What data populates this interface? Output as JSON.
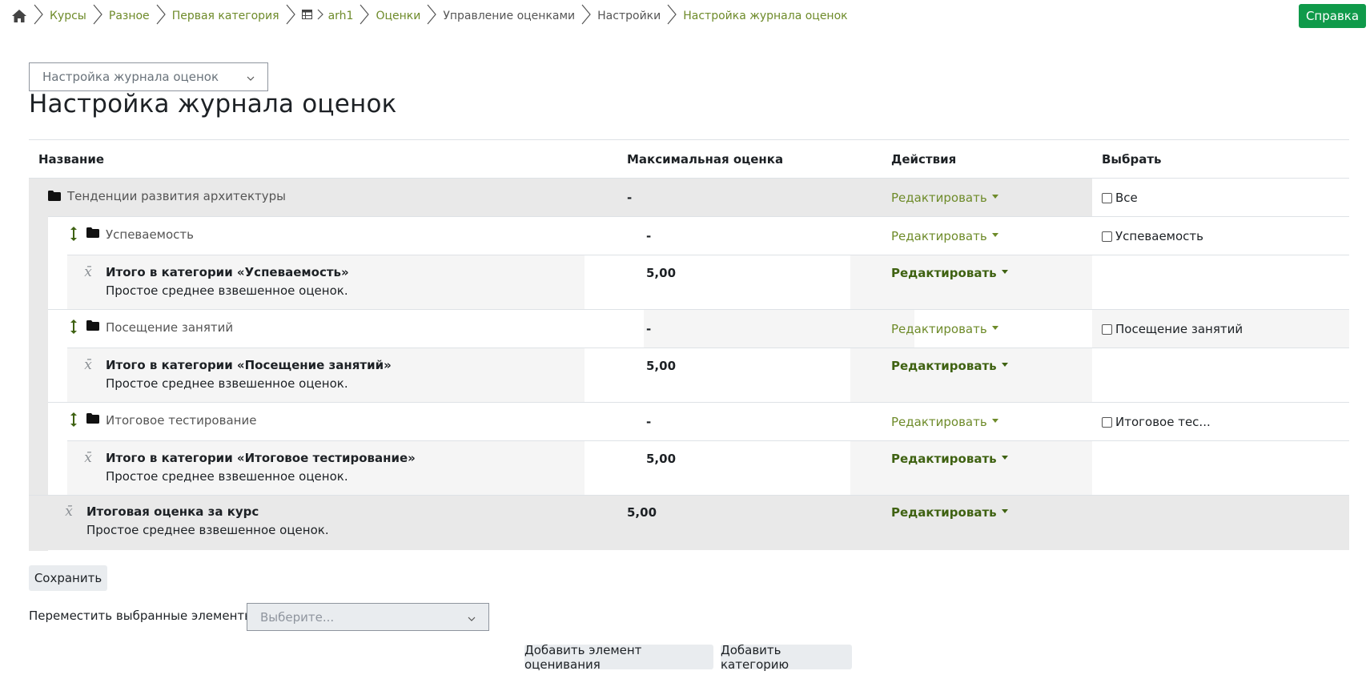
{
  "breadcrumb": {
    "items": [
      {
        "label": "Курсы",
        "link": true
      },
      {
        "label": "Разное",
        "link": true
      },
      {
        "label": "Первая категория",
        "link": true
      },
      {
        "label": "arh1",
        "link": true
      },
      {
        "label": "Оценки",
        "link": true
      },
      {
        "label": "Управление оценками",
        "link": false
      },
      {
        "label": "Настройки",
        "link": false
      },
      {
        "label": "Настройка журнала оценок",
        "link": true
      }
    ]
  },
  "help_button": "Справка",
  "nav_select": {
    "value": "Настройка журнала оценок"
  },
  "page_title": "Настройка журнала оценок",
  "table": {
    "headers": {
      "name": "Название",
      "max": "Максимальная оценка",
      "actions": "Действия",
      "select": "Выбрать"
    },
    "edit_label": "Редактировать",
    "rows": {
      "root": {
        "name": "Тенденции развития архитектуры",
        "max": "-",
        "select": "Все"
      },
      "cat1": {
        "name": "Успеваемость",
        "max": "-",
        "select": "Успеваемость"
      },
      "total1": {
        "name": "Итого в категории «Успеваемость»",
        "sub": "Простое среднее взвешенное оценок.",
        "max": "5,00"
      },
      "cat2": {
        "name": "Посещение занятий",
        "max": "-",
        "select": "Посещение занятий"
      },
      "total2": {
        "name": "Итого в категории «Посещение занятий»",
        "sub": "Простое среднее взвешенное оценок.",
        "max": "5,00"
      },
      "cat3": {
        "name": "Итоговое тестирование",
        "max": "-",
        "select": "Итоговое тес..."
      },
      "total3": {
        "name": "Итого в категории «Итоговое тестирование»",
        "sub": "Простое среднее взвешенное оценок.",
        "max": "5,00"
      },
      "course": {
        "name": "Итоговая оценка за курс",
        "sub": "Простое среднее взвешенное оценок.",
        "max": "5,00"
      }
    }
  },
  "save_button": "Сохранить",
  "move": {
    "label": "Переместить выбранные элементы в",
    "placeholder": "Выберите..."
  },
  "buttons": {
    "add_item": "Добавить элемент оценивания",
    "add_category": "Добавить категорию"
  },
  "colors": {
    "accent": "#6e8b2a",
    "help": "#0f9a4a",
    "row_grey": "#e9e9e9"
  }
}
